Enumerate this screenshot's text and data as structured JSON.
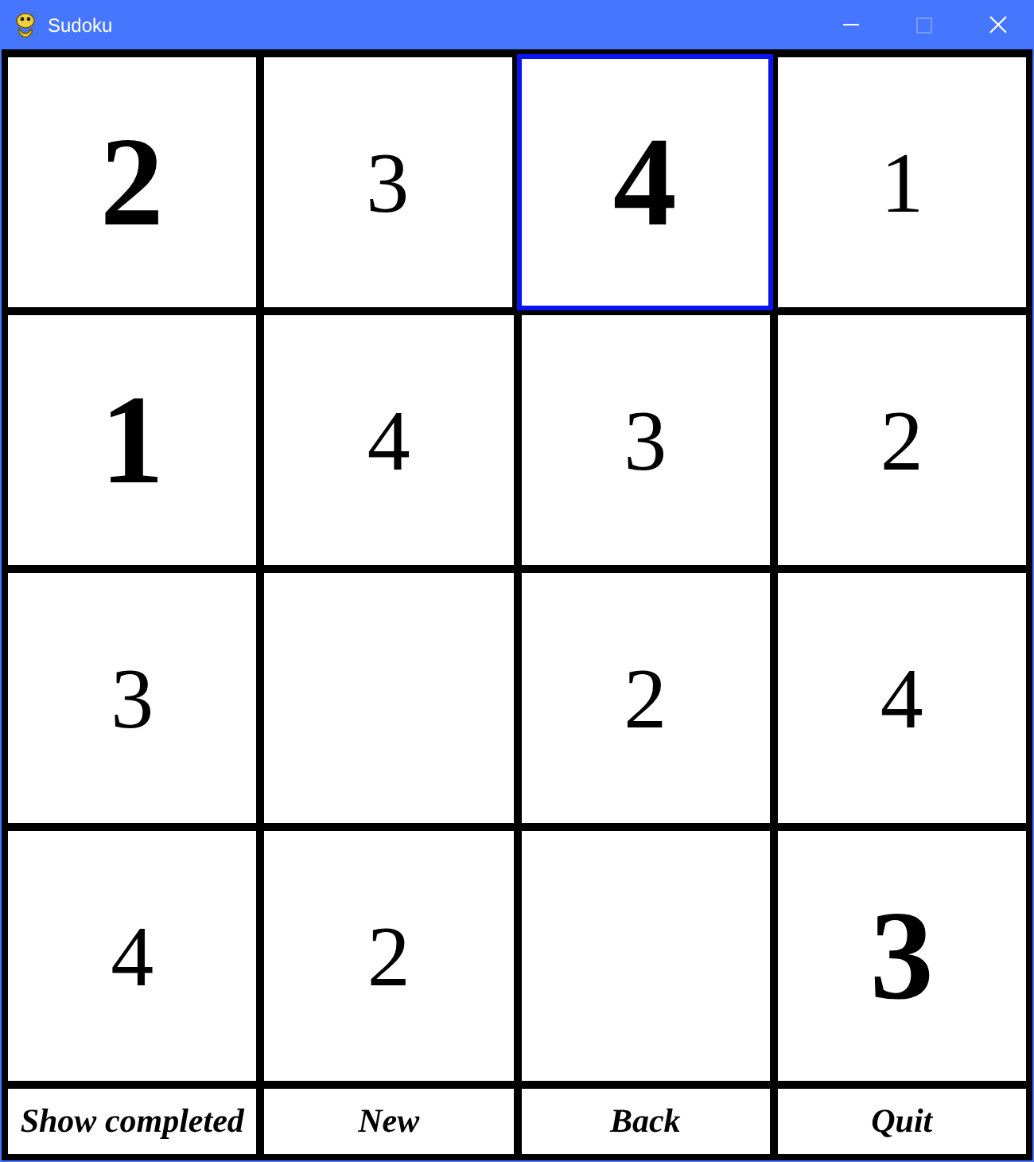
{
  "window": {
    "title": "Sudoku",
    "maximize_disabled": true
  },
  "board": {
    "rows": [
      {
        "cells": [
          {
            "value": "2",
            "given": true,
            "selected": false
          },
          {
            "value": "3",
            "given": false,
            "selected": false
          },
          {
            "value": "4",
            "given": true,
            "selected": true
          },
          {
            "value": "1",
            "given": false,
            "selected": false
          }
        ]
      },
      {
        "cells": [
          {
            "value": "1",
            "given": true,
            "selected": false
          },
          {
            "value": "4",
            "given": false,
            "selected": false
          },
          {
            "value": "3",
            "given": false,
            "selected": false
          },
          {
            "value": "2",
            "given": false,
            "selected": false
          }
        ]
      },
      {
        "cells": [
          {
            "value": "3",
            "given": false,
            "selected": false
          },
          {
            "selected": false
          },
          {
            "value": "2",
            "given": false,
            "selected": false
          },
          {
            "value": "4",
            "given": false,
            "selected": false
          }
        ]
      },
      {
        "cells": [
          {
            "value": "4",
            "given": false,
            "selected": false
          },
          {
            "value": "2",
            "given": false,
            "selected": false
          },
          {
            "selected": false
          },
          {
            "value": "3",
            "given": true,
            "selected": false
          }
        ]
      }
    ]
  },
  "buttons": [
    "Show completed",
    "New",
    "Back",
    "Quit"
  ]
}
